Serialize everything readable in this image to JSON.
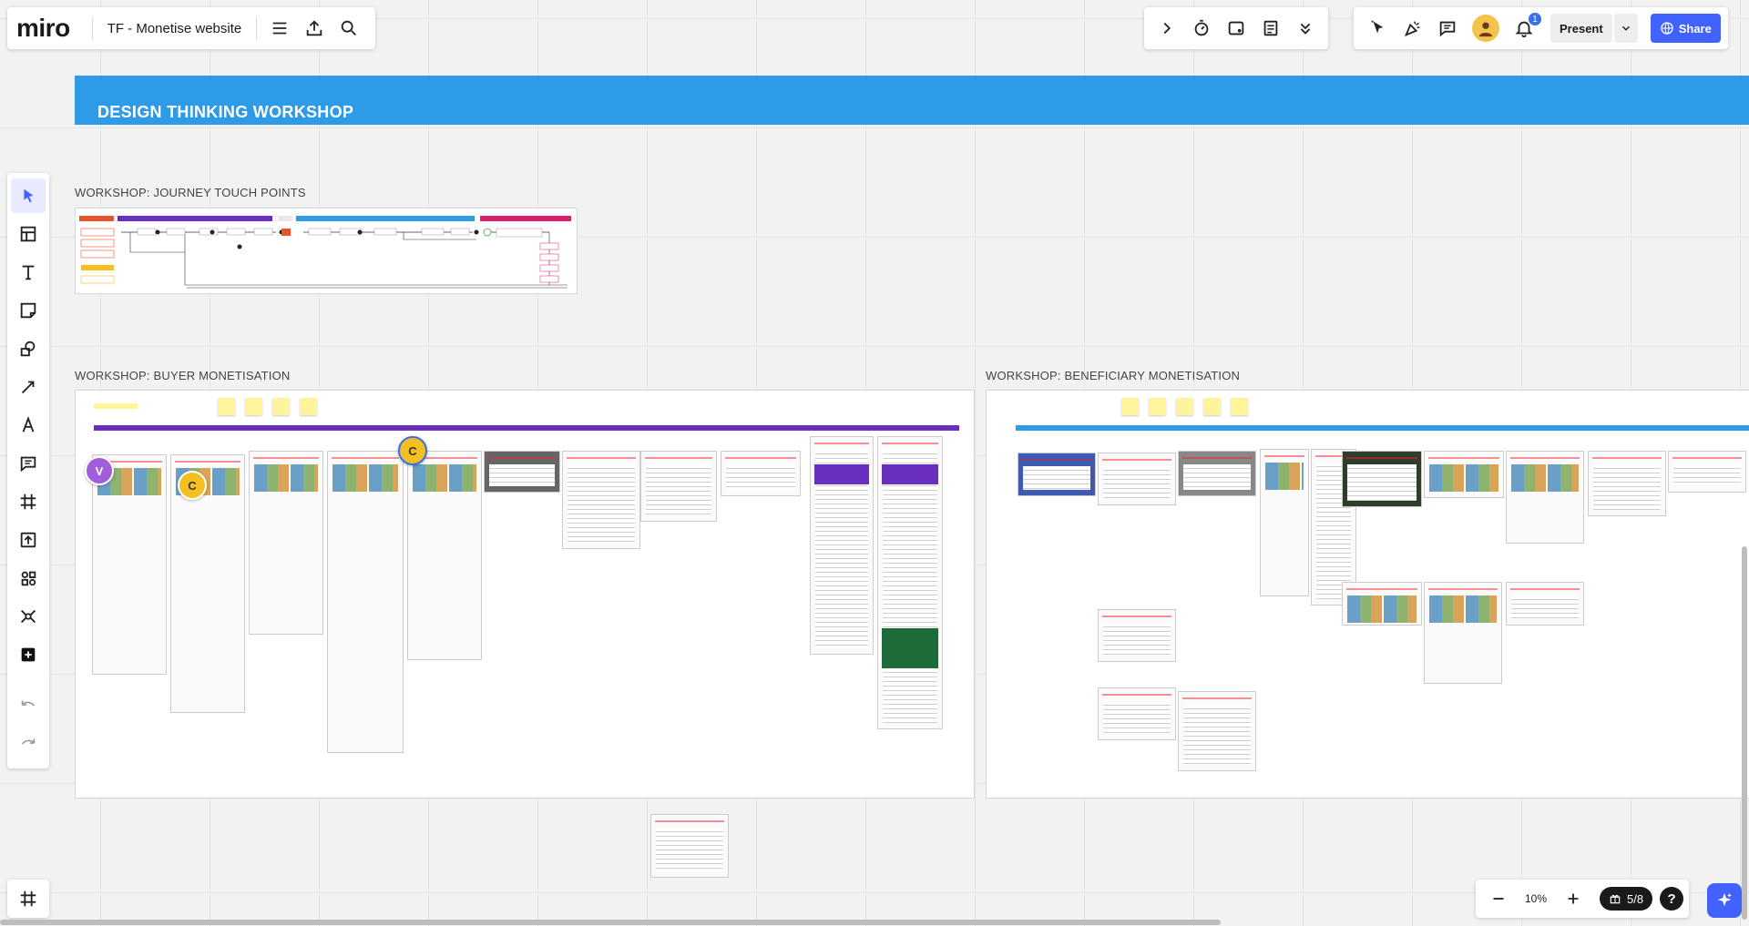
{
  "app": {
    "logo": "miro",
    "board_title": "TF - Monetise website"
  },
  "header": {
    "present_label": "Present",
    "share_label": "Share",
    "notification_count": "1",
    "avatar_initial": ""
  },
  "board": {
    "banner_title": "DESIGN THINKING WORKSHOP",
    "frames": {
      "journey": "WORKSHOP: JOURNEY TOUCH POINTS",
      "buyer": "WORKSHOP: BUYER MONETISATION",
      "beneficiary": "WORKSHOP: BENEFICIARY MONETISATION"
    },
    "cursors": [
      {
        "initial": "V",
        "color": "#a25ddc"
      },
      {
        "initial": "C",
        "color": "#f4c020"
      },
      {
        "initial": "C",
        "color": "#f4c020"
      }
    ],
    "colors": {
      "banner": "#2d9be8",
      "purple_bar": "#6b2fbf",
      "accent": "#4262ff"
    }
  },
  "footer": {
    "zoom_level": "10%",
    "page_indicator": "5/8",
    "help_label": "?"
  }
}
